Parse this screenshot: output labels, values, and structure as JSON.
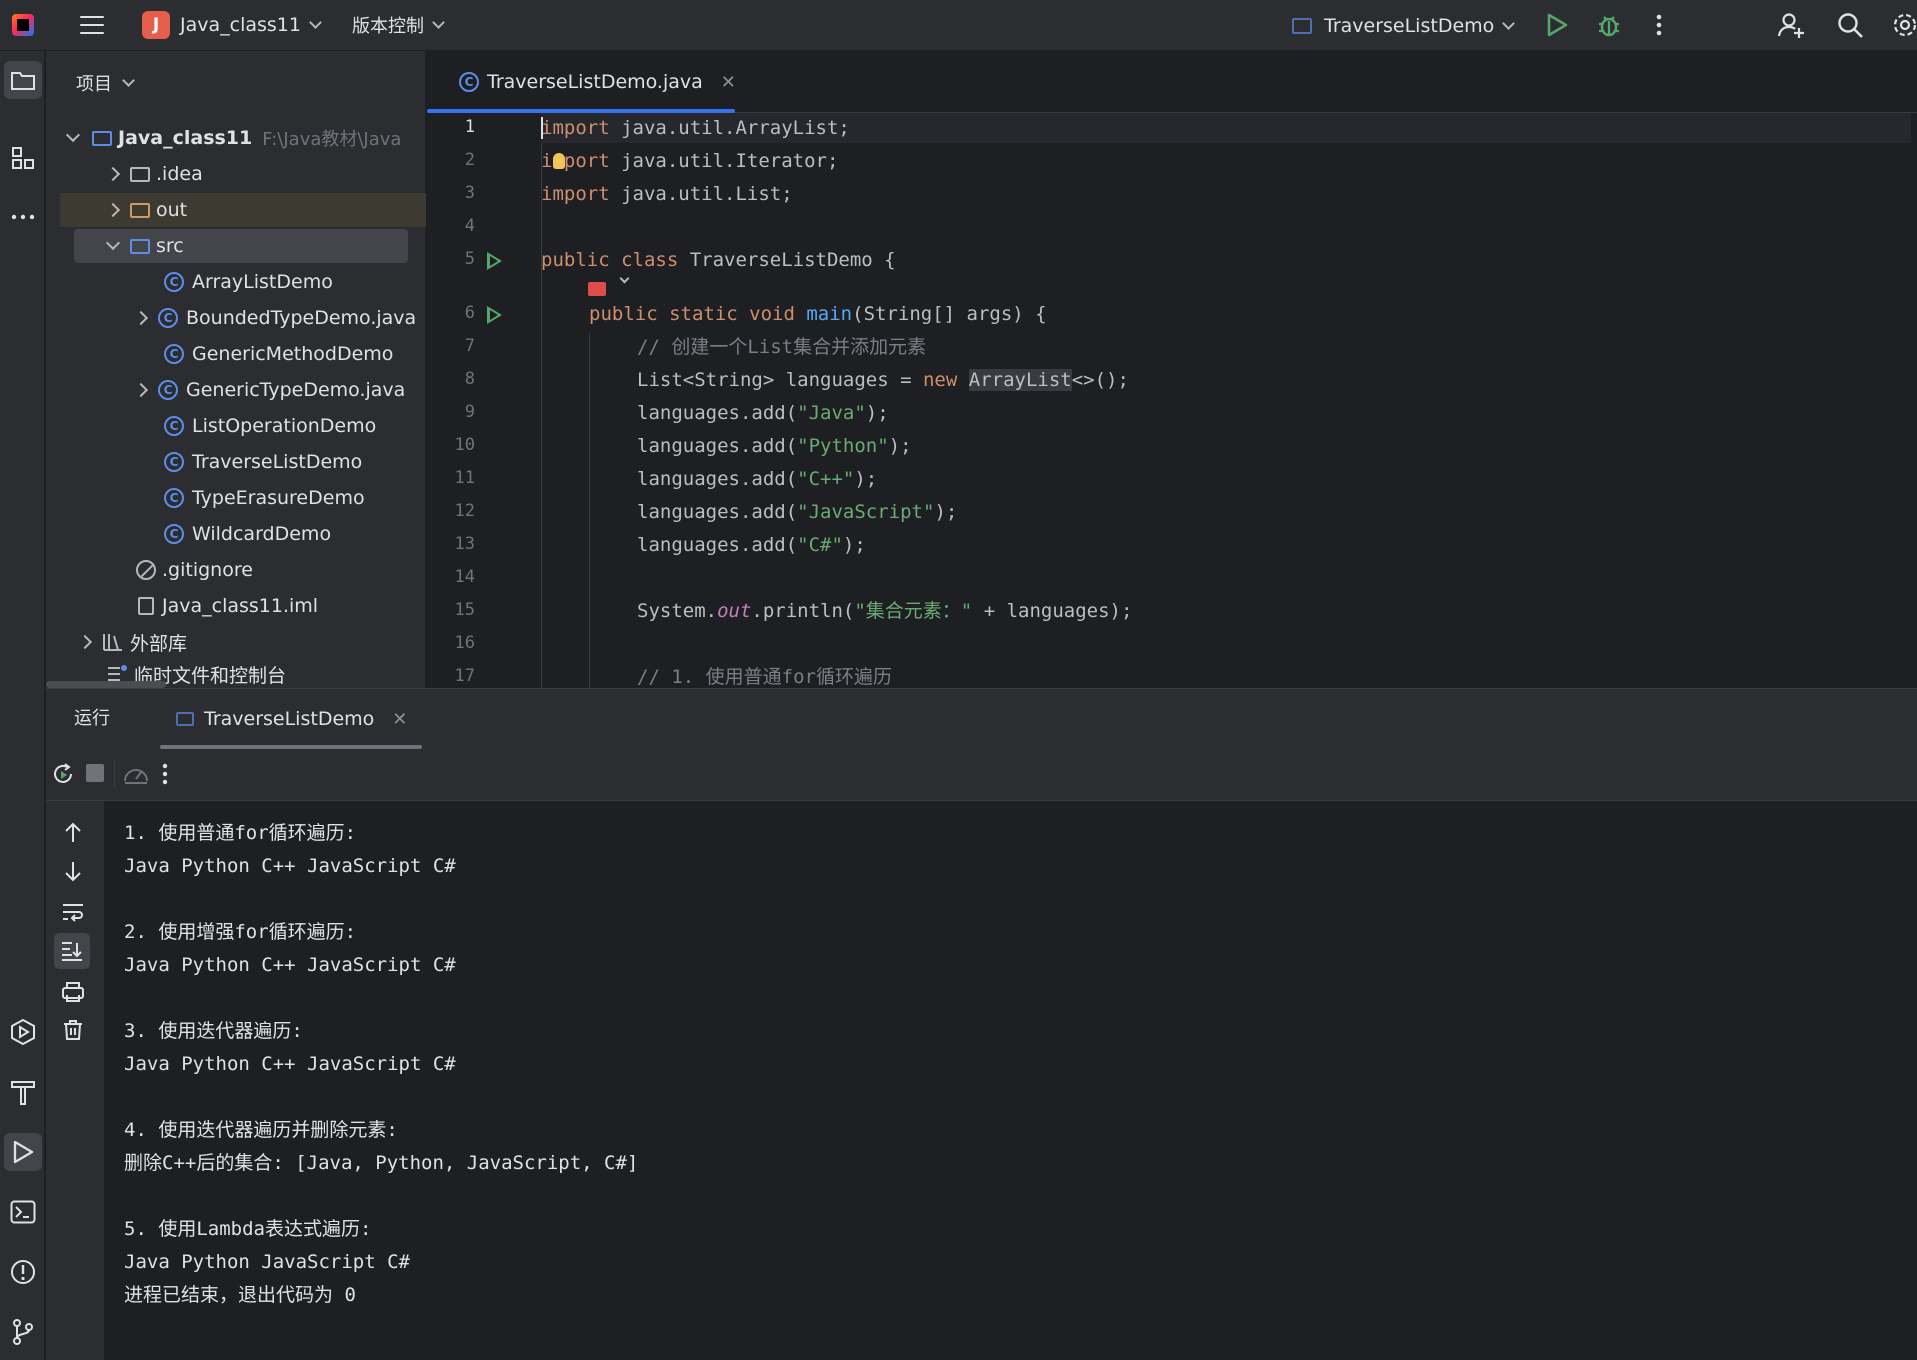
{
  "window": {
    "project_name": "Java_class11",
    "project_badge": "J",
    "vcs_menu": "版本控制",
    "run_config": "TraverseListDemo"
  },
  "project_panel": {
    "title": "项目",
    "tree": [
      {
        "label": "Java_class11",
        "path": "F:\\Java教材\\Java"
      },
      {
        "label": ".idea"
      },
      {
        "label": "out"
      },
      {
        "label": "src"
      },
      {
        "label": "ArrayListDemo"
      },
      {
        "label": "BoundedTypeDemo.java"
      },
      {
        "label": "GenericMethodDemo"
      },
      {
        "label": "GenericTypeDemo.java"
      },
      {
        "label": "ListOperationDemo"
      },
      {
        "label": "TraverseListDemo"
      },
      {
        "label": "TypeErasureDemo"
      },
      {
        "label": "WildcardDemo"
      },
      {
        "label": ".gitignore"
      },
      {
        "label": "Java_class11.iml"
      },
      {
        "label": "外部库"
      },
      {
        "label": "临时文件和控制台"
      }
    ]
  },
  "editor": {
    "tab_label": "TraverseListDemo.java",
    "line_numbers": [
      "1",
      "2",
      "3",
      "4",
      "5",
      "6",
      "7",
      "8",
      "9",
      "10",
      "11",
      "12",
      "13",
      "14",
      "15",
      "16",
      "17"
    ],
    "code": {
      "l1_kw": "import",
      "l1_rest": " java.util.ArrayList;",
      "l2_kw": "import",
      "l2_rest": " java.util.Iterator;",
      "l3_kw": "import",
      "l3_rest": " java.util.List;",
      "l5_kw": "public class",
      "l5_rest": " TraverseListDemo {",
      "l6_kw": "public static void",
      "l6_fn": "main",
      "l6_rest": "(String[] args) {",
      "l7_cmt": "// 创建一个List集合并添加元素",
      "l8_a": "List<String> languages = ",
      "l8_kw": "new",
      "l8_type": "ArrayList",
      "l8_b": "<>();",
      "l9_a": "languages.add(",
      "l9_s": "\"Java\"",
      "l9_b": ");",
      "l10_a": "languages.add(",
      "l10_s": "\"Python\"",
      "l10_b": ");",
      "l11_a": "languages.add(",
      "l11_s": "\"C++\"",
      "l11_b": ");",
      "l12_a": "languages.add(",
      "l12_s": "\"JavaScript\"",
      "l12_b": ");",
      "l13_a": "languages.add(",
      "l13_s": "\"C#\"",
      "l13_b": ");",
      "l15_a": "System.",
      "l15_st": "out",
      "l15_b": ".println(",
      "l15_s": "\"集合元素：\"",
      "l15_c": " + languages);",
      "l17_cmt": "// 1. 使用普通for循环遍历"
    }
  },
  "run_panel": {
    "title": "运行",
    "tab_label": "TraverseListDemo",
    "output": [
      "1. 使用普通for循环遍历:",
      "Java Python C++ JavaScript C#",
      "",
      "2. 使用增强for循环遍历:",
      "Java Python C++ JavaScript C#",
      "",
      "3. 使用迭代器遍历:",
      "Java Python C++ JavaScript C#",
      "",
      "4. 使用迭代器遍历并删除元素:",
      "删除C++后的集合: [Java, Python, JavaScript, C#]",
      "",
      "5. 使用Lambda表达式遍历:",
      "Java Python JavaScript C#",
      "进程已结束，退出代码为 0"
    ]
  },
  "colors": {
    "accent": "#3574f0",
    "run_green": "#55a76a",
    "keyword": "#cf8e6d",
    "string": "#6aab73"
  }
}
